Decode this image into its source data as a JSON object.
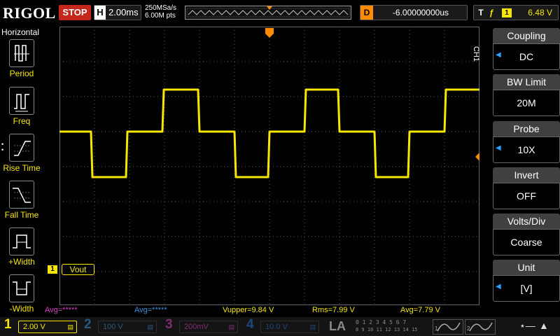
{
  "topbar": {
    "brand": "RIGOL",
    "run_state": "STOP",
    "timebase_label": "H",
    "timebase": "2.00ms",
    "sample_rate": "250MSa/s",
    "memory_depth": "6.00M pts",
    "delay_label": "D",
    "delay": "-6.00000000us",
    "trigger_label": "T",
    "trigger_edge": "ƒ",
    "trigger_source": "1",
    "trigger_level": "6.48 V"
  },
  "left_menu": {
    "title": "Horizontal",
    "items": [
      {
        "label": "Period",
        "icon": "period-icon"
      },
      {
        "label": "Freq",
        "icon": "freq-icon"
      },
      {
        "label": "Rise Time",
        "icon": "rise-time-icon"
      },
      {
        "label": "Fall Time",
        "icon": "fall-time-icon"
      },
      {
        "label": "+Width",
        "icon": "plus-width-icon"
      },
      {
        "label": "-Width",
        "icon": "minus-width-icon"
      }
    ]
  },
  "channel_side_label": "CH1",
  "right_menu": {
    "items": [
      {
        "label": "Coupling",
        "value": "DC"
      },
      {
        "label": "BW Limit",
        "value": "20M"
      },
      {
        "label": "Probe",
        "value": "10X"
      },
      {
        "label": "Invert",
        "value": "OFF"
      },
      {
        "label": "Volts/Div",
        "value": "Coarse"
      },
      {
        "label": "Unit",
        "value": "[V]"
      }
    ]
  },
  "trace": {
    "marker_label": "1",
    "name": "Vout",
    "color": "#f6e600"
  },
  "measurements": {
    "avg1": "Avg=*****",
    "avg2": "Avg=*****",
    "vupper": "Vupper=9.84 V",
    "rms": "Rms=7.99 V",
    "avg": "Avg=7.79 V"
  },
  "channels": [
    {
      "num": "1",
      "scale": "2.00 V",
      "color": "#f6e600",
      "active": true
    },
    {
      "num": "2",
      "scale": "100 V",
      "color": "#3a8fd8",
      "active": false
    },
    {
      "num": "3",
      "scale": "200mV",
      "color": "#d040c0",
      "active": false
    },
    {
      "num": "4",
      "scale": "10.0 V",
      "color": "#2a6fd8",
      "active": false
    }
  ],
  "bottom": {
    "la_label": "LA",
    "la_digits_top": "0 1 2 3  4 5 6 7",
    "la_digits_bottom": "8 9 10 11  12 13 14 15",
    "gen1": "1",
    "gen2": "2"
  }
}
